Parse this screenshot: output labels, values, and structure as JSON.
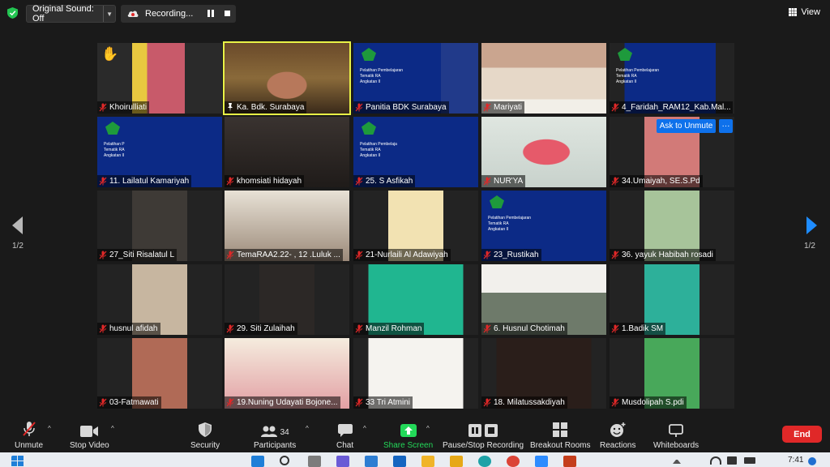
{
  "topbar": {
    "original_sound": "Original Sound: Off",
    "recording": "Recording...",
    "view": "View"
  },
  "unmute_prompt": "Ask to Unmute",
  "more": "···",
  "page_left": "1/2",
  "page_right": "1/2",
  "participants": [
    {
      "name": "Khoirulliati",
      "hand": "✋"
    },
    {
      "name": "Ka. Bdk. Surabaya",
      "active": true
    },
    {
      "name": "Panitia BDK Surabaya",
      "slide": [
        "Pelatihan Pembelajaran",
        "Tematik RA",
        "Angkatan II"
      ]
    },
    {
      "name": "Mariyati"
    },
    {
      "name": "4_Faridah_RAM12_Kab.Mal...",
      "slide": [
        "Pelatihan Pembelajaran",
        "Tematik RA",
        "Angkatan II"
      ]
    },
    {
      "name": "11. Lailatul Kamariyah",
      "slide": [
        "Pelatihan P",
        "Tematik RA",
        "Angkatan II"
      ]
    },
    {
      "name": "khomsiati hidayah"
    },
    {
      "name": "25. S Asfikah",
      "slide": [
        "Pelatihan Pembelaja",
        "Tematik RA",
        "Angkatan II"
      ]
    },
    {
      "name": "NUR'YA"
    },
    {
      "name": "34.Umaiyah, SE.S.Pd"
    },
    {
      "name": "27_Siti Risalatul L"
    },
    {
      "name": "TemaRAA2.22- , 12 .Luluk ..."
    },
    {
      "name": "21-Nurlaili Al Adawiyah"
    },
    {
      "name": "23_Rustikah",
      "slide": [
        "Pelatihan Pembelajaran",
        "Tematik RA",
        "Angkatan II"
      ]
    },
    {
      "name": "36. yayuk Habibah rosadi"
    },
    {
      "name": "husnul afidah"
    },
    {
      "name": "29. Siti Zulaihah"
    },
    {
      "name": "Manzil Rohman"
    },
    {
      "name": "6. Husnul Chotimah"
    },
    {
      "name": "1.Badik SM"
    },
    {
      "name": "03-Fatmawati"
    },
    {
      "name": "19.Nuning Udayati Bojone..."
    },
    {
      "name": "33 Tri Atmini"
    },
    {
      "name": "18. Milatussakdiyah"
    },
    {
      "name": "Musdolipah S.pdi"
    }
  ],
  "toolbar": {
    "unmute": "Unmute",
    "stop_video": "Stop Video",
    "security": "Security",
    "participants": "Participants",
    "participants_count": "34",
    "chat": "Chat",
    "share_screen": "Share Screen",
    "pause_recording": "Pause/Stop Recording",
    "breakout": "Breakout Rooms",
    "reactions": "Reactions",
    "whiteboards": "Whiteboards",
    "end": "End"
  },
  "taskbar": {
    "time": "7:41"
  },
  "colors": {
    "accent_blue": "#0e71eb",
    "share_green": "#23d959",
    "end_red": "#e02828",
    "active_speaker": "#e8f246",
    "muted_red": "#e02828"
  }
}
